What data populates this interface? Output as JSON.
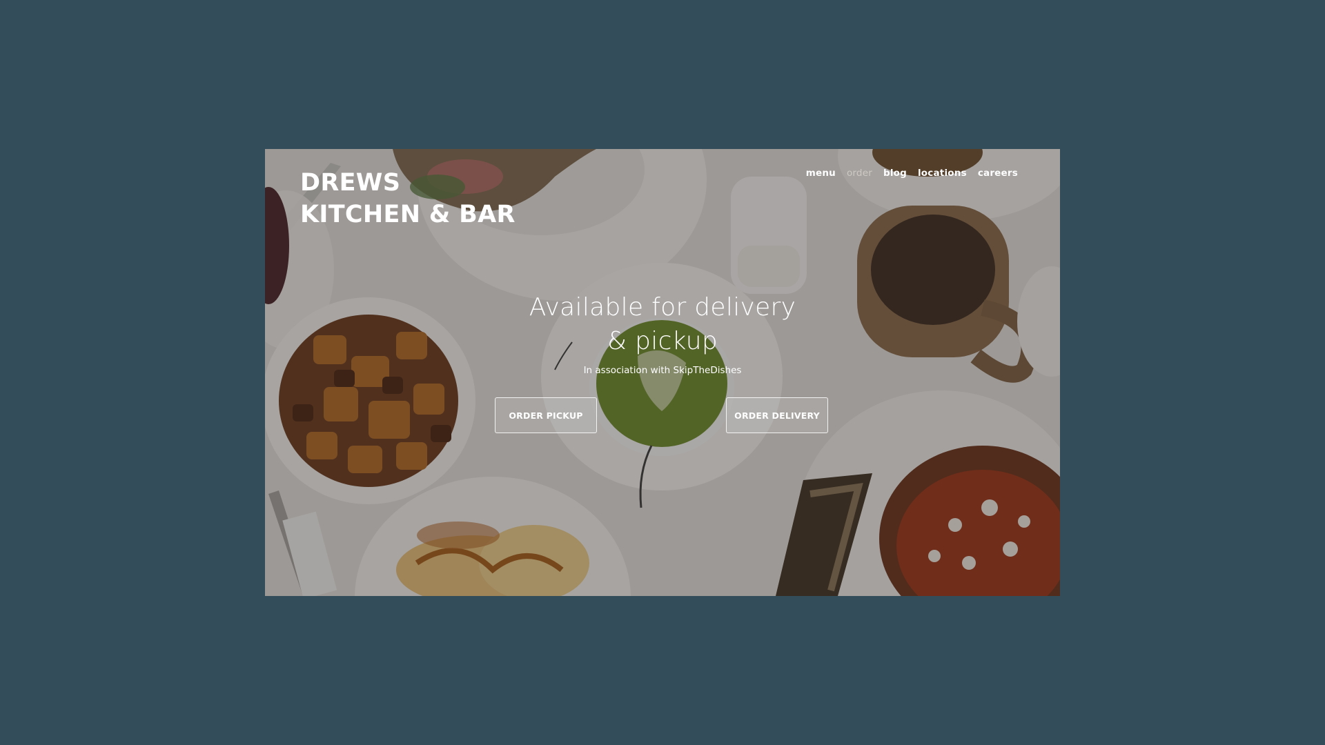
{
  "brand": {
    "line1": "DREWS",
    "line2": "KITCHEN & BAR"
  },
  "nav": {
    "items": [
      {
        "label": "menu"
      },
      {
        "label": "order",
        "current": true
      },
      {
        "label": "blog"
      },
      {
        "label": "locations"
      },
      {
        "label": "careers"
      }
    ]
  },
  "hero": {
    "title_line1": "Available for delivery",
    "title_line2": "& pickup",
    "subtitle": "In association with SkipTheDishes"
  },
  "buttons": {
    "pickup": "ORDER PICKUP",
    "delivery": "ORDER DELIVERY"
  },
  "colors": {
    "page_background": "#344d5a",
    "text": "#ffffff"
  }
}
